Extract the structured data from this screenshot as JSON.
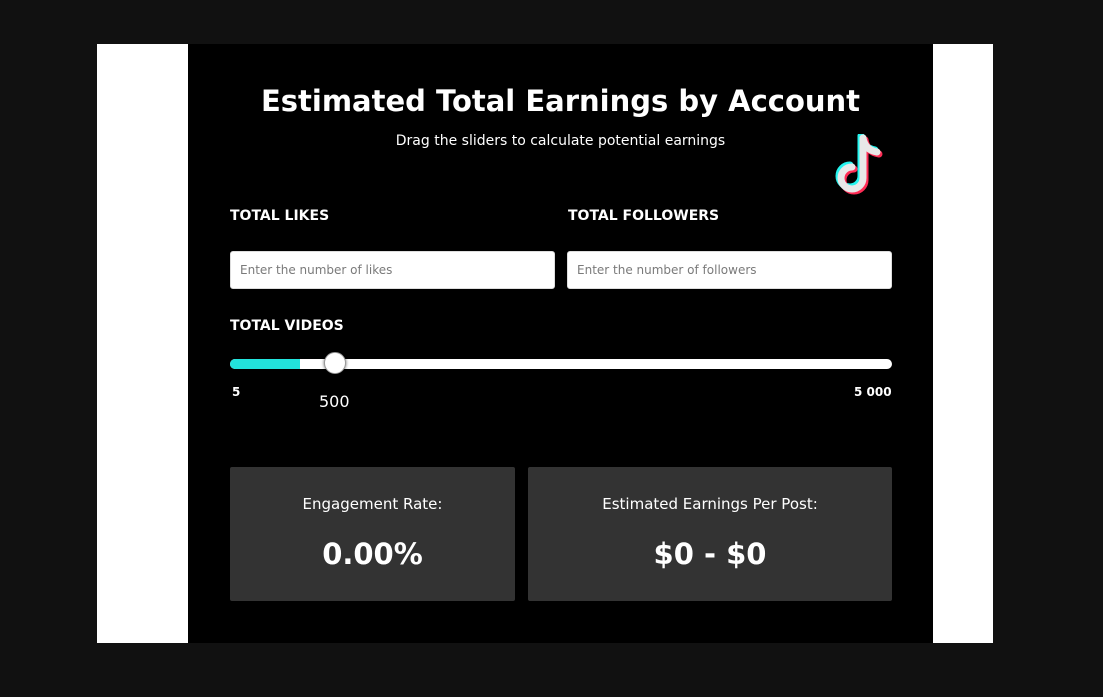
{
  "calculator": {
    "title": "Estimated Total Earnings by Account",
    "subtitle": "Drag the sliders to calculate potential earnings",
    "logo_icon": "tiktok-logo-icon",
    "likes": {
      "label": "TOTAL LIKES",
      "value": "",
      "placeholder": "Enter the number of likes"
    },
    "followers": {
      "label": "TOTAL FOLLOWERS",
      "value": "",
      "placeholder": "Enter the number of followers"
    },
    "videos": {
      "label": "TOTAL VIDEOS",
      "min_label": "5",
      "max_label": "5 000",
      "min": 5,
      "max": 5000,
      "value": 500,
      "value_label": "500"
    },
    "engagement": {
      "label": "Engagement Rate:",
      "value": "0.00%"
    },
    "earnings": {
      "label": "Estimated Earnings Per Post:",
      "value": "$0 - $0"
    }
  },
  "colors": {
    "accent": "#22e3dc",
    "panel_bg": "#000000",
    "card_bg": "#333333",
    "logo_cyan": "#25f4ee",
    "logo_red": "#fe2c55"
  }
}
